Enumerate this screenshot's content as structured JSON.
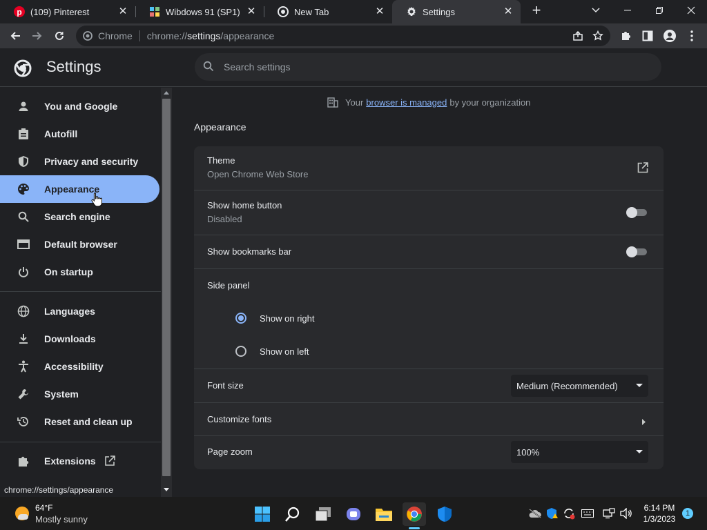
{
  "browser": {
    "tabs": [
      {
        "title": "(109) Pinterest",
        "icon": "pinterest-icon"
      },
      {
        "title": "Wibdows 91 (SP1)",
        "icon": "wibdows-icon"
      },
      {
        "title": "New Tab",
        "icon": "chrome-icon"
      },
      {
        "title": "Settings",
        "icon": "gear-icon"
      }
    ],
    "omnibox": {
      "site": "Chrome",
      "url_scheme": "chrome://",
      "url_host": "settings",
      "url_path": "/appearance"
    }
  },
  "settings": {
    "title": "Settings",
    "search_placeholder": "Search settings",
    "managed": {
      "before": "Your",
      "link": "browser is managed",
      "after": "by your organization"
    },
    "nav": [
      {
        "label": "You and Google",
        "icon": "person-icon"
      },
      {
        "label": "Autofill",
        "icon": "clipboard-icon"
      },
      {
        "label": "Privacy and security",
        "icon": "shield-icon"
      },
      {
        "label": "Appearance",
        "icon": "palette-icon",
        "active": true
      },
      {
        "label": "Search engine",
        "icon": "search-icon"
      },
      {
        "label": "Default browser",
        "icon": "browser-window-icon"
      },
      {
        "label": "On startup",
        "icon": "power-icon"
      },
      {
        "label": "Languages",
        "icon": "globe-icon"
      },
      {
        "label": "Downloads",
        "icon": "download-icon"
      },
      {
        "label": "Accessibility",
        "icon": "accessibility-icon"
      },
      {
        "label": "System",
        "icon": "wrench-icon"
      },
      {
        "label": "Reset and clean up",
        "icon": "restore-icon"
      },
      {
        "label": "Extensions",
        "icon": "puzzle-icon"
      }
    ],
    "section_title": "Appearance",
    "theme": {
      "label": "Theme",
      "sub": "Open Chrome Web Store"
    },
    "home_button": {
      "label": "Show home button",
      "sub": "Disabled",
      "enabled": false
    },
    "bookmarks_bar": {
      "label": "Show bookmarks bar",
      "enabled": false
    },
    "side_panel": {
      "label": "Side panel",
      "options": [
        "Show on right",
        "Show on left"
      ],
      "selected": "Show on right"
    },
    "font_size": {
      "label": "Font size",
      "value": "Medium (Recommended)"
    },
    "customize_fonts": {
      "label": "Customize fonts"
    },
    "page_zoom": {
      "label": "Page zoom",
      "value": "100%"
    },
    "status_url": "chrome://settings/appearance"
  },
  "taskbar": {
    "weather": {
      "temp": "64°F",
      "desc": "Mostly sunny"
    },
    "time": "6:14 PM",
    "date": "1/3/2023",
    "notification_count": "1"
  }
}
